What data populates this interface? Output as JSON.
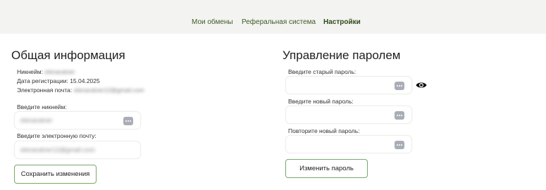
{
  "nav": {
    "items": [
      {
        "label": "Мои обмены"
      },
      {
        "label": "Реферальная система"
      },
      {
        "label": "Настройки",
        "active": true
      }
    ]
  },
  "general": {
    "title": "Общая информация",
    "nickname_label": "Никнейм:",
    "nickname_value": "elenaratner",
    "regdate_label": "Дата регистрации:",
    "regdate_value": "15.04.2025",
    "email_label": "Электронная почта:",
    "email_value": "elenaratner12@gmail.com",
    "nickname_input_label": "Введите никнейм:",
    "nickname_input_value": "elenaratner",
    "email_input_label": "Введите электронную почту:",
    "email_input_value": "elenaratner12@gmail.com",
    "save_button": "Сохранить изменения"
  },
  "password": {
    "title": "Управление паролем",
    "old_label": "Введите старый пароль:",
    "new_label": "Введите новый пароль:",
    "repeat_label": "Повторите новый пароль:",
    "change_button": "Изменить пароль"
  },
  "colors": {
    "accent": "#3f5a26",
    "button_border": "#7aa86a",
    "nav_background": "#f3f3f1",
    "key_icon": "#a9aeb6"
  },
  "icons": {
    "field_action": "password-manager-key-icon",
    "toggle_visibility": "eye-icon"
  }
}
